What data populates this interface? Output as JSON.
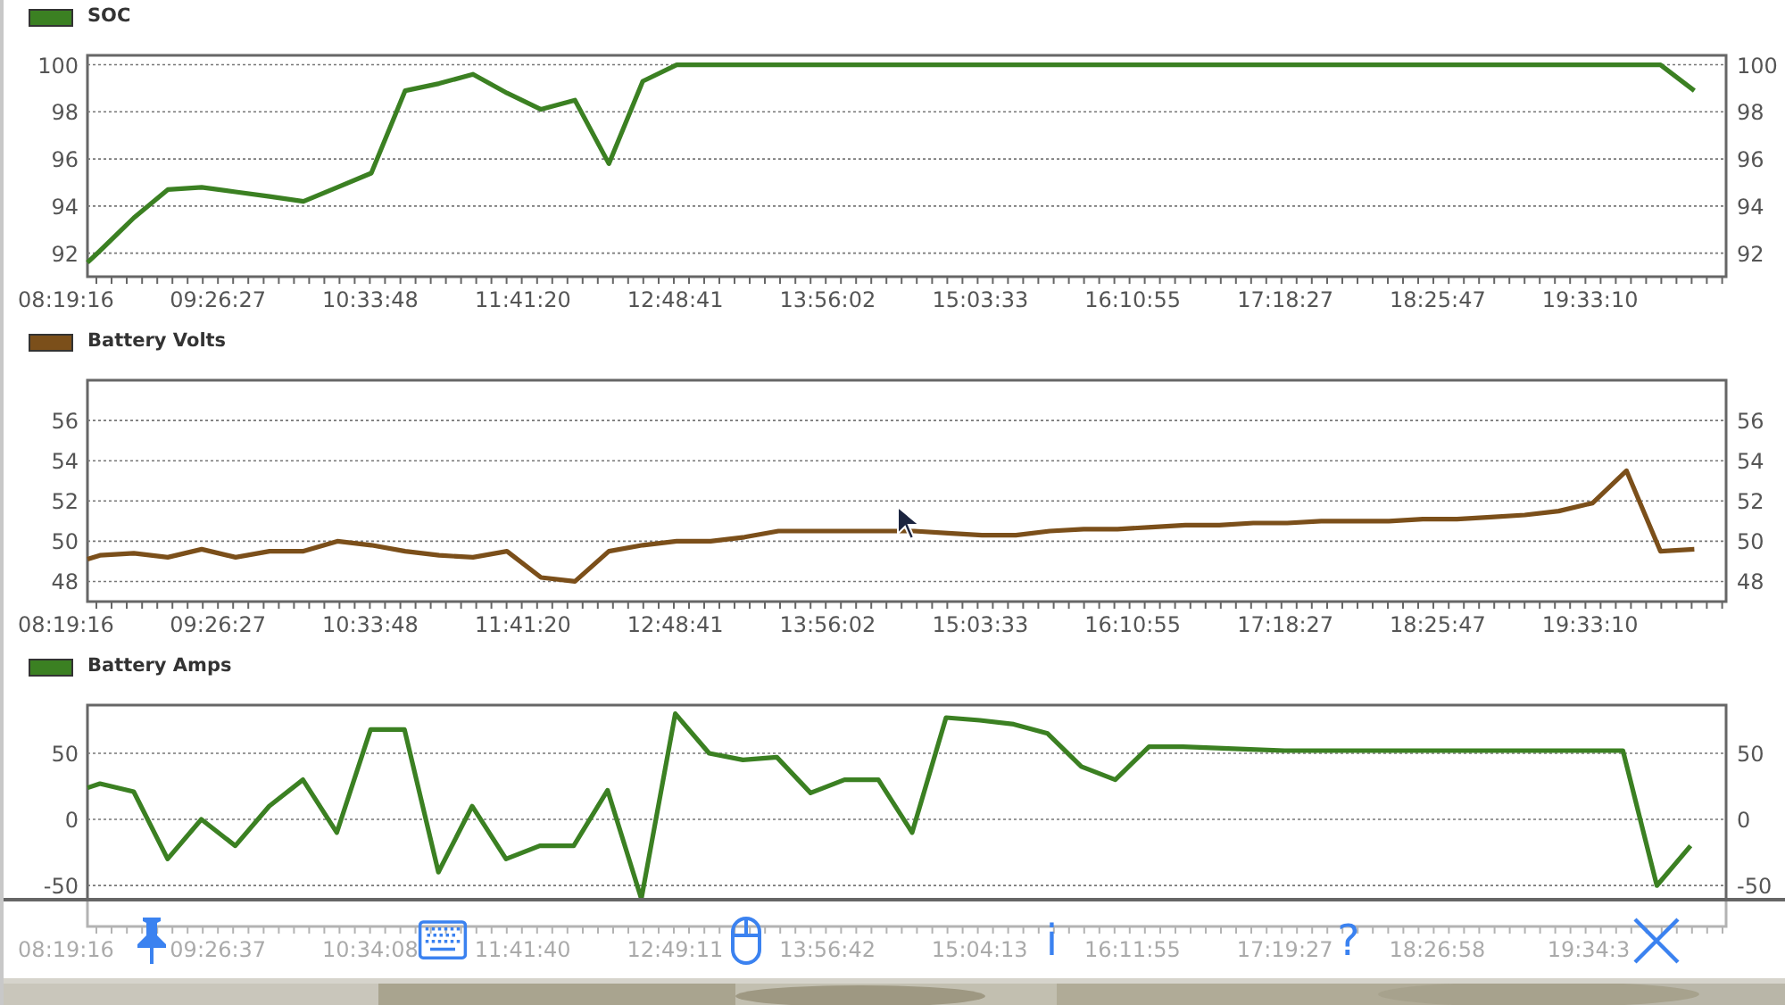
{
  "charts": [
    {
      "chart_data": {
        "type": "line",
        "grid": true,
        "xlim": [
          29956,
          74000
        ],
        "ylim": [
          91,
          100.4
        ],
        "y2lim": [
          91,
          100.4
        ],
        "yticks": [
          92,
          94,
          96,
          98,
          100
        ],
        "y2ticks": [
          92,
          94,
          96,
          98,
          100
        ],
        "xticks": [
          {
            "value": 29956,
            "label": "08:19:16"
          },
          {
            "value": 33987,
            "label": "09:26:27"
          },
          {
            "value": 38028,
            "label": "10:33:48"
          },
          {
            "value": 42080,
            "label": "11:41:20"
          },
          {
            "value": 46121,
            "label": "12:48:41"
          },
          {
            "value": 50162,
            "label": "13:56:02"
          },
          {
            "value": 54213,
            "label": "15:03:33"
          },
          {
            "value": 58255,
            "label": "16:10:55"
          },
          {
            "value": 62307,
            "label": "17:18:27"
          },
          {
            "value": 66347,
            "label": "18:25:47"
          },
          {
            "value": 70390,
            "label": "19:33:10"
          }
        ],
        "x": [
          30525,
          30856,
          31756,
          32656,
          33556,
          34456,
          35356,
          36256,
          37156,
          38056,
          38956,
          39856,
          40756,
          41656,
          42556,
          43456,
          44356,
          45256,
          46156,
          47056,
          47956,
          48856,
          49756,
          50656,
          51556,
          52456,
          53356,
          54256,
          55156,
          56056,
          56956,
          57856,
          58756,
          59656,
          60556,
          61456,
          62356,
          63256,
          64156,
          65056,
          65956,
          66856,
          67756,
          68656,
          69556,
          70456,
          71356,
          72256,
          73156
        ],
        "series": [
          {
            "name": "SOC",
            "color": "#3b8022",
            "values": [
              91.6,
              92.1,
              93.5,
              94.7,
              94.8,
              94.6,
              94.4,
              94.2,
              94.8,
              95.4,
              98.9,
              99.2,
              99.6,
              98.8,
              98.1,
              98.5,
              95.8,
              99.3,
              100,
              100,
              100,
              100,
              100,
              100,
              100,
              100,
              100,
              100,
              100,
              100,
              100,
              100,
              100,
              100,
              100,
              100,
              100,
              100,
              100,
              100,
              100,
              100,
              100,
              100,
              100,
              100,
              100,
              100,
              98.9
            ]
          }
        ]
      }
    },
    {
      "chart_data": {
        "type": "line",
        "grid": true,
        "xlim": [
          29956,
          74000
        ],
        "ylim": [
          47,
          58
        ],
        "y2lim": [
          47,
          58
        ],
        "yticks": [
          48,
          50,
          52,
          54,
          56
        ],
        "y2ticks": [
          48,
          50,
          52,
          54,
          56
        ],
        "xticks": [
          {
            "value": 29956,
            "label": "08:19:16"
          },
          {
            "value": 33987,
            "label": "09:26:27"
          },
          {
            "value": 38028,
            "label": "10:33:48"
          },
          {
            "value": 42080,
            "label": "11:41:20"
          },
          {
            "value": 46121,
            "label": "12:48:41"
          },
          {
            "value": 50162,
            "label": "13:56:02"
          },
          {
            "value": 54213,
            "label": "15:03:33"
          },
          {
            "value": 58255,
            "label": "16:10:55"
          },
          {
            "value": 62307,
            "label": "17:18:27"
          },
          {
            "value": 66347,
            "label": "18:25:47"
          },
          {
            "value": 70390,
            "label": "19:33:10"
          }
        ],
        "x": [
          30525,
          30856,
          31756,
          32656,
          33556,
          34456,
          35356,
          36256,
          37156,
          38056,
          38956,
          39856,
          40756,
          41656,
          42556,
          43456,
          44356,
          45256,
          46156,
          47056,
          47956,
          48856,
          49756,
          50656,
          51556,
          52456,
          53356,
          54256,
          55156,
          56056,
          56956,
          57856,
          58756,
          59656,
          60556,
          61456,
          62356,
          63256,
          64156,
          65056,
          65956,
          66856,
          67756,
          68656,
          69556,
          70456,
          71356,
          72256,
          73156
        ],
        "series": [
          {
            "name": "Battery Volts",
            "color": "#7b4f1a",
            "values": [
              49.1,
              49.3,
              49.4,
              49.2,
              49.6,
              49.2,
              49.5,
              49.5,
              50,
              49.8,
              49.5,
              49.3,
              49.2,
              49.5,
              48.2,
              48,
              49.5,
              49.8,
              50,
              50,
              50.2,
              50.5,
              50.5,
              50.5,
              50.5,
              50.5,
              50.4,
              50.3,
              50.3,
              50.5,
              50.6,
              50.6,
              50.7,
              50.8,
              50.8,
              50.9,
              50.9,
              51,
              51,
              51,
              51.1,
              51.1,
              51.2,
              51.3,
              51.5,
              51.9,
              53.5,
              49.5,
              49.6
            ]
          }
        ]
      }
    },
    {
      "chart_data": {
        "type": "line",
        "grid": true,
        "xlim": [
          29956,
          74100
        ],
        "ylim": [
          -81,
          86.5
        ],
        "y2lim": [
          -81,
          86.5
        ],
        "yticks": [
          -50,
          0,
          50
        ],
        "y2ticks": [
          -50,
          0,
          50
        ],
        "xticks": [
          {
            "value": 29956,
            "label": "08:19:16"
          },
          {
            "value": 33997,
            "label": "09:26:37"
          },
          {
            "value": 38048,
            "label": "10:34:08"
          },
          {
            "value": 42100,
            "label": "11:41:40"
          },
          {
            "value": 46151,
            "label": "12:49:11"
          },
          {
            "value": 50202,
            "label": "13:56:42"
          },
          {
            "value": 54253,
            "label": "15:04:13"
          },
          {
            "value": 58315,
            "label": "16:11:55"
          },
          {
            "value": 62367,
            "label": "17:19:27"
          },
          {
            "value": 66418,
            "label": "18:26:58"
          },
          {
            "value": 70443,
            "label": "19:34:3"
          }
        ],
        "x": [
          30530,
          30856,
          31756,
          32656,
          33556,
          34456,
          35356,
          36256,
          37156,
          38056,
          38956,
          39856,
          40756,
          41656,
          42556,
          43456,
          44356,
          45256,
          46156,
          47056,
          47956,
          48856,
          49756,
          50656,
          51556,
          52456,
          53356,
          54256,
          55156,
          56056,
          56956,
          57856,
          58756,
          59656,
          60556,
          61456,
          62356,
          63256,
          64156,
          65056,
          65956,
          66856,
          67756,
          68656,
          69556,
          70456,
          71356,
          72256,
          73156
        ],
        "series": [
          {
            "name": "Battery Amps",
            "color": "#3b8022",
            "values": [
              24,
              27,
              21,
              -30,
              0,
              -20,
              10,
              30,
              -10,
              68,
              68,
              -40,
              10,
              -30,
              -20,
              -20,
              22,
              -60,
              80,
              50,
              45,
              47,
              20,
              30,
              30,
              -10,
              77,
              75,
              72,
              65,
              40,
              30,
              55,
              55,
              54,
              53,
              52,
              52,
              52,
              52,
              52,
              52,
              52,
              52,
              52,
              52,
              52,
              -50,
              -20
            ]
          }
        ]
      }
    }
  ],
  "toolbar": {
    "buttons": [
      {
        "kind": "pin"
      },
      {
        "kind": "keyboard"
      },
      {
        "kind": "mouse"
      },
      {
        "kind": "text",
        "label": "i"
      },
      {
        "kind": "text",
        "label": "?"
      },
      {
        "kind": "close"
      }
    ]
  }
}
